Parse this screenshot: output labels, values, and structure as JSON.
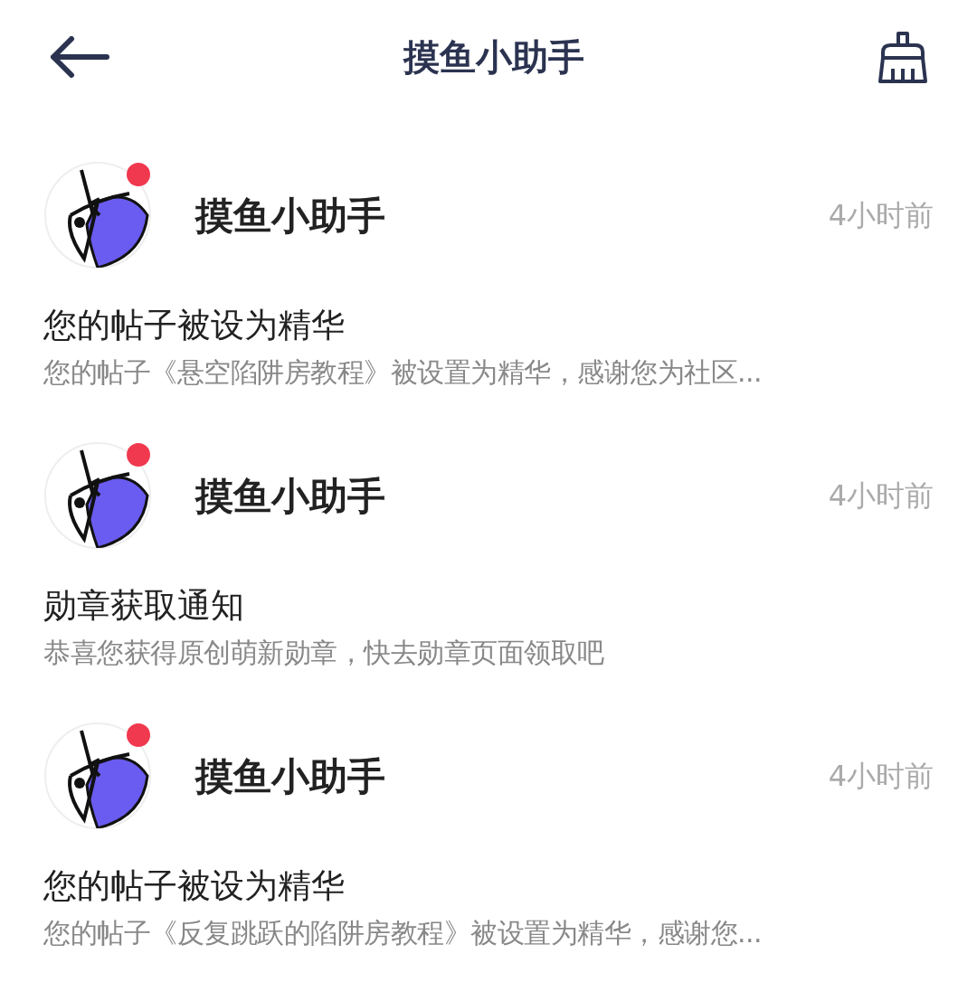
{
  "header": {
    "title": "摸鱼小助手"
  },
  "messages": [
    {
      "sender": "摸鱼小助手",
      "unread": true,
      "time": "4小时前",
      "title": "您的帖子被设为精华",
      "body": "您的帖子《悬空陷阱房教程》被设置为精华，感谢您为社区..."
    },
    {
      "sender": "摸鱼小助手",
      "unread": true,
      "time": "4小时前",
      "title": "勋章获取通知",
      "body": "恭喜您获得原创萌新勋章，快去勋章页面领取吧"
    },
    {
      "sender": "摸鱼小助手",
      "unread": true,
      "time": "4小时前",
      "title": "您的帖子被设为精华",
      "body": "您的帖子《反复跳跃的陷阱房教程》被设置为精华，感谢您..."
    }
  ]
}
